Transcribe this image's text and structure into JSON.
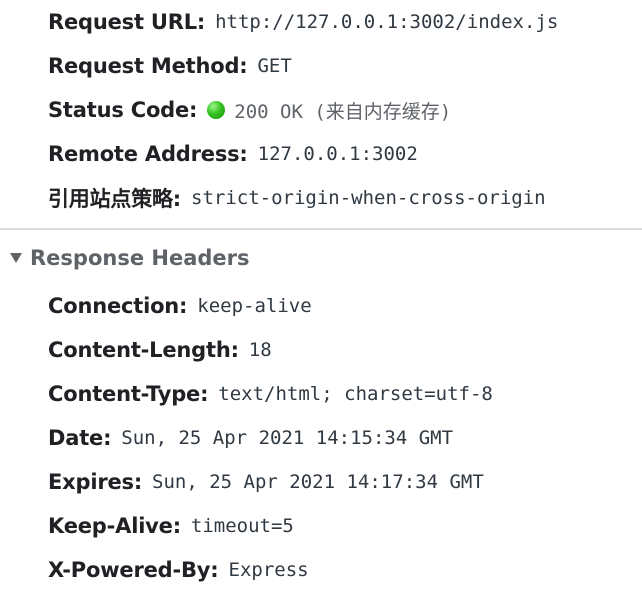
{
  "general": {
    "request_url": {
      "key": "Request URL:",
      "value": "http://127.0.0.1:3002/index.js"
    },
    "request_method": {
      "key": "Request Method:",
      "value": "GET"
    },
    "status_code": {
      "key": "Status Code:",
      "value": "200 OK (来自内存缓存)",
      "indicator": "green-dot-icon",
      "indicator_color": "#33c21e"
    },
    "remote_address": {
      "key": "Remote Address:",
      "value": "127.0.0.1:3002"
    },
    "referrer_policy": {
      "key": "引用站点策略:",
      "value": "strict-origin-when-cross-origin"
    }
  },
  "response_headers": {
    "title": "Response Headers",
    "expanded": true,
    "items": [
      {
        "key": "Connection:",
        "value": "keep-alive"
      },
      {
        "key": "Content-Length:",
        "value": "18"
      },
      {
        "key": "Content-Type:",
        "value": "text/html; charset=utf-8"
      },
      {
        "key": "Date:",
        "value": "Sun, 25 Apr 2021 14:15:34 GMT"
      },
      {
        "key": "Expires:",
        "value": "Sun, 25 Apr 2021 14:17:34 GMT"
      },
      {
        "key": "Keep-Alive:",
        "value": "timeout=5"
      },
      {
        "key": "X-Powered-By:",
        "value": "Express"
      }
    ]
  }
}
